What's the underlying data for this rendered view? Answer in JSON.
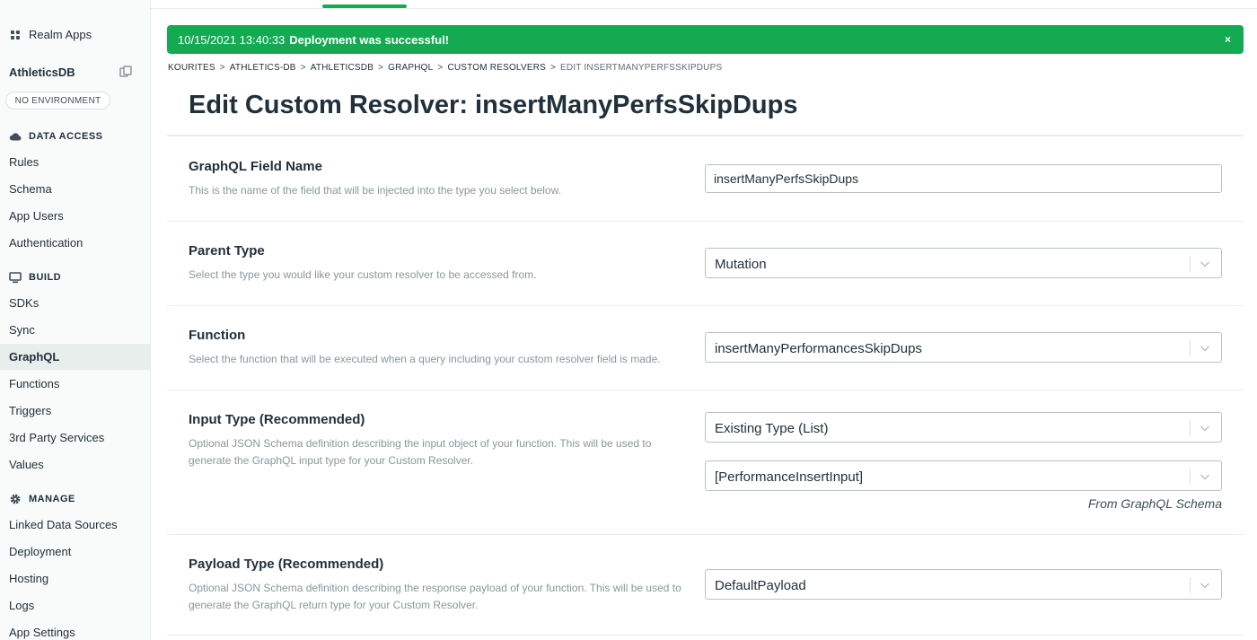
{
  "sidebar": {
    "realm_apps_label": "Realm Apps",
    "app_name": "AthleticsDB",
    "environment": "NO ENVIRONMENT",
    "sections": {
      "data_access": {
        "title": "DATA ACCESS",
        "icon": "cloud-icon",
        "items": [
          "Rules",
          "Schema",
          "App Users",
          "Authentication"
        ]
      },
      "build": {
        "title": "BUILD",
        "icon": "monitor-icon",
        "items": [
          "SDKs",
          "Sync",
          "GraphQL",
          "Functions",
          "Triggers",
          "3rd Party Services",
          "Values"
        ]
      },
      "manage": {
        "title": "MANAGE",
        "icon": "gear-icon",
        "items": [
          "Linked Data Sources",
          "Deployment",
          "Hosting",
          "Logs",
          "App Settings"
        ]
      }
    },
    "active_item": "GraphQL"
  },
  "banner": {
    "timestamp": "10/15/2021 13:40:33",
    "message": "Deployment was successful!",
    "close_label": "×",
    "color": "#13aa52"
  },
  "breadcrumb": [
    "KOURITES",
    "ATHLETICS-DB",
    "ATHLETICSDB",
    "GRAPHQL",
    "CUSTOM RESOLVERS",
    "EDIT INSERTMANYPERFSSKIPDUPS"
  ],
  "breadcrumb_separator": ">",
  "page_title": "Edit Custom Resolver: insertManyPerfsSkipDups",
  "form": {
    "field_name": {
      "label": "GraphQL Field Name",
      "description": "This is the name of the field that will be injected into the type you select below.",
      "value": "insertManyPerfsSkipDups"
    },
    "parent_type": {
      "label": "Parent Type",
      "description": "Select the type you would like your custom resolver to be accessed from.",
      "value": "Mutation"
    },
    "function": {
      "label": "Function",
      "description": "Select the function that will be executed when a query including your custom resolver field is made.",
      "value": "insertManyPerformancesSkipDups"
    },
    "input_type": {
      "label": "Input Type (Recommended)",
      "description": "Optional JSON Schema definition describing the input object of your function. This will be used to generate the GraphQL input type for your Custom Resolver.",
      "value": "Existing Type (List)",
      "type_value": "[PerformanceInsertInput]",
      "note": "From GraphQL Schema"
    },
    "payload_type": {
      "label": "Payload Type (Recommended)",
      "description": "Optional JSON Schema definition describing the response payload of your function. This will be used to generate the GraphQL return type for your Custom Resolver.",
      "value": "DefaultPayload"
    }
  }
}
